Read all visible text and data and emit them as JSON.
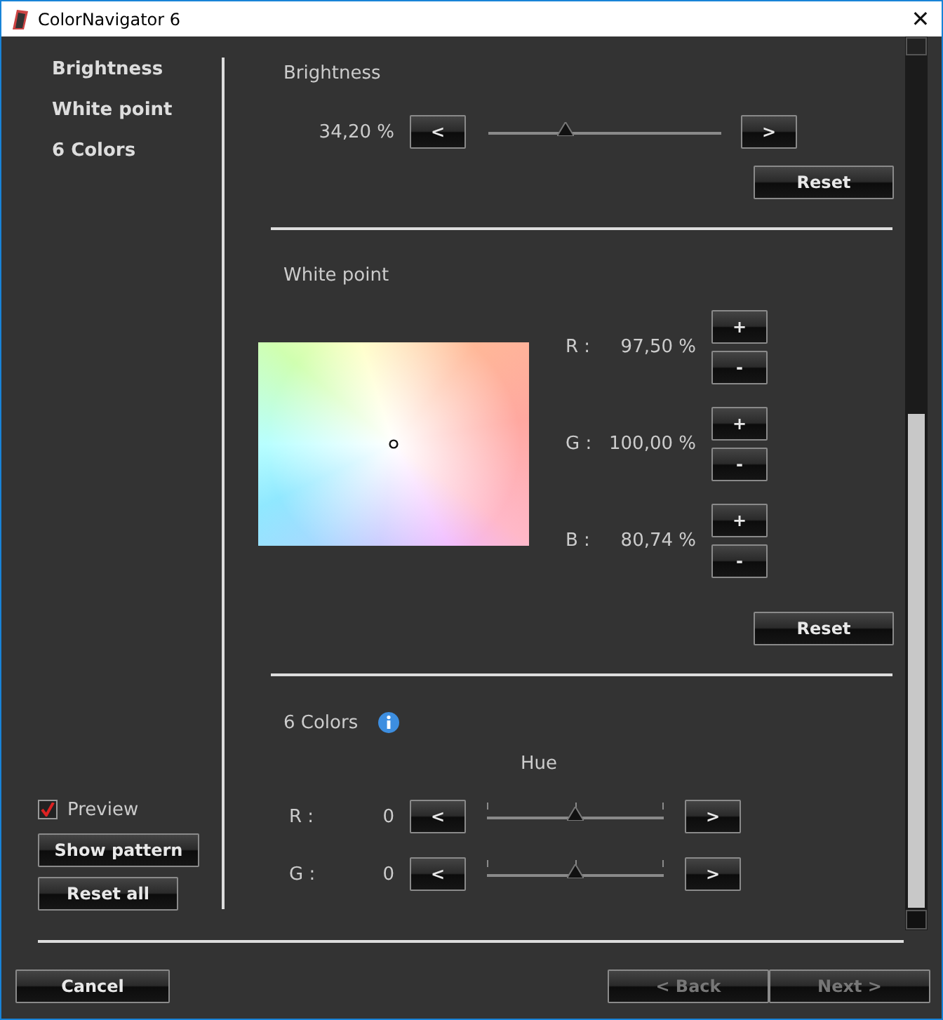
{
  "window": {
    "title": "ColorNavigator 6",
    "close": "✕"
  },
  "sidebar": {
    "items": [
      {
        "label": "Brightness"
      },
      {
        "label": "White point"
      },
      {
        "label": "6 Colors"
      }
    ],
    "preview": {
      "label": "Preview",
      "checked": true
    },
    "buttons": [
      "Show pattern",
      "Reset all"
    ]
  },
  "brightness": {
    "title": "Brightness",
    "reading": "34,20 %",
    "decrease": "<",
    "increase": ">",
    "level": 0.33,
    "reset": "Reset"
  },
  "white_point": {
    "title": "White point",
    "channels": [
      {
        "label": "R :",
        "reading": "97,50 %",
        "plus": "+",
        "minus": "-"
      },
      {
        "label": "G :",
        "reading": "100,00 %",
        "plus": "+",
        "minus": "-"
      },
      {
        "label": "B :",
        "reading": "80,74 %",
        "plus": "+",
        "minus": "-"
      }
    ],
    "reset": "Reset"
  },
  "six_colors": {
    "title": "6 Colors",
    "hue_title": "Hue",
    "rows": [
      {
        "label": "R :",
        "value": "0",
        "decrease": "<",
        "increase": ">",
        "level": 0.5
      },
      {
        "label": "G :",
        "value": "0",
        "decrease": "<",
        "increase": ">",
        "level": 0.5
      }
    ]
  },
  "footer": {
    "cancel": "Cancel",
    "back": {
      "label": "< Back",
      "disabled": true
    },
    "next": {
      "label": "Next >",
      "disabled": true
    }
  }
}
